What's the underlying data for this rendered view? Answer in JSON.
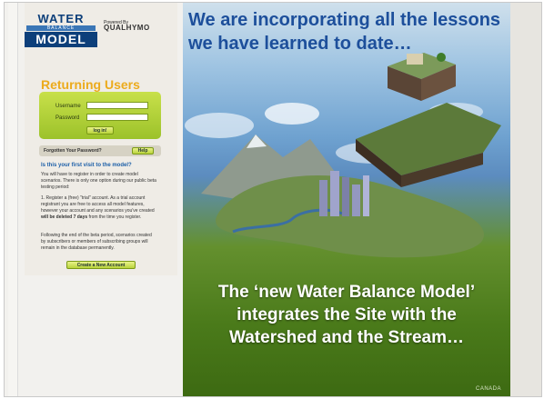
{
  "sidebar": {
    "logo": {
      "line1": "WATER",
      "line2": "BALANCE",
      "line3": "MODEL"
    },
    "powered_by": "Powered By",
    "brand": "QUALHYMO",
    "returning_users": "Returning Users",
    "username_label": "Username",
    "password_label": "Password",
    "username_value": "",
    "password_value": "",
    "login_button": "log in!",
    "forgot_text": "Forgotten Your Password?",
    "help_button": "Help",
    "first_visit_question": "Is this your first visit to the model?",
    "paragraph_1": "You will have to register in order to create model scenarios. There is only one option during our public beta testing period:",
    "paragraph_2_pre": "1.  Register a (free) \"trial\" account. As a trial account registrant you are free to access all model features, however your account and any scenarios you've created ",
    "paragraph_2_bold": "will be deleted 7 days",
    "paragraph_2_post": " from the time you register.",
    "paragraph_3": "Following the end of the beta period, scenarios created by subscribers or members of subscribing groups will remain in the database permanently.",
    "create_account_button": "Create a New Account"
  },
  "promo": {
    "headline_line1": "We are incorporating all the lessons",
    "headline_line2": "we have learned to date…",
    "bottom_line1": "The ‘new Water Balance Model’",
    "bottom_line2": "integrates the Site with the",
    "bottom_line3": "Watershed and the Stream…",
    "watermark": "CANADA"
  },
  "colors": {
    "headline": "#1d4f9b",
    "returning_users": "#ecab1c",
    "login_box": "#b5d43a",
    "question": "#1c5fa8"
  }
}
